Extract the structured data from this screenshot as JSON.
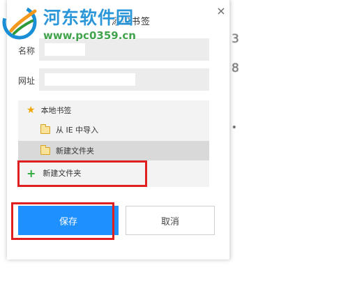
{
  "watermark": {
    "site_name": "河东软件园",
    "site_url": "www.pc0359.cn"
  },
  "dialog": {
    "title": "添加书签",
    "close_glyph": "×",
    "name_label": "名称",
    "url_label": "网址",
    "name_value": "",
    "url_value": ""
  },
  "folder_tree": {
    "items": [
      {
        "label": "本地书签",
        "icon": "star-icon"
      },
      {
        "label": "从 IE 中导入",
        "icon": "folder-icon"
      },
      {
        "label": "新建文件夹",
        "icon": "folder-icon",
        "selected": true
      }
    ],
    "new_folder_label": "新建文件夹"
  },
  "buttons": {
    "save_label": "保存",
    "cancel_label": "取消"
  },
  "background_glyphs": [
    "3",
    "8",
    "•"
  ],
  "colors": {
    "primary": "#1e90ff",
    "highlight": "#e02020",
    "star": "#f0a500",
    "plus": "#2eaa3a",
    "watermark_blue": "#1a8fd6",
    "watermark_green": "#2e9a3a"
  }
}
